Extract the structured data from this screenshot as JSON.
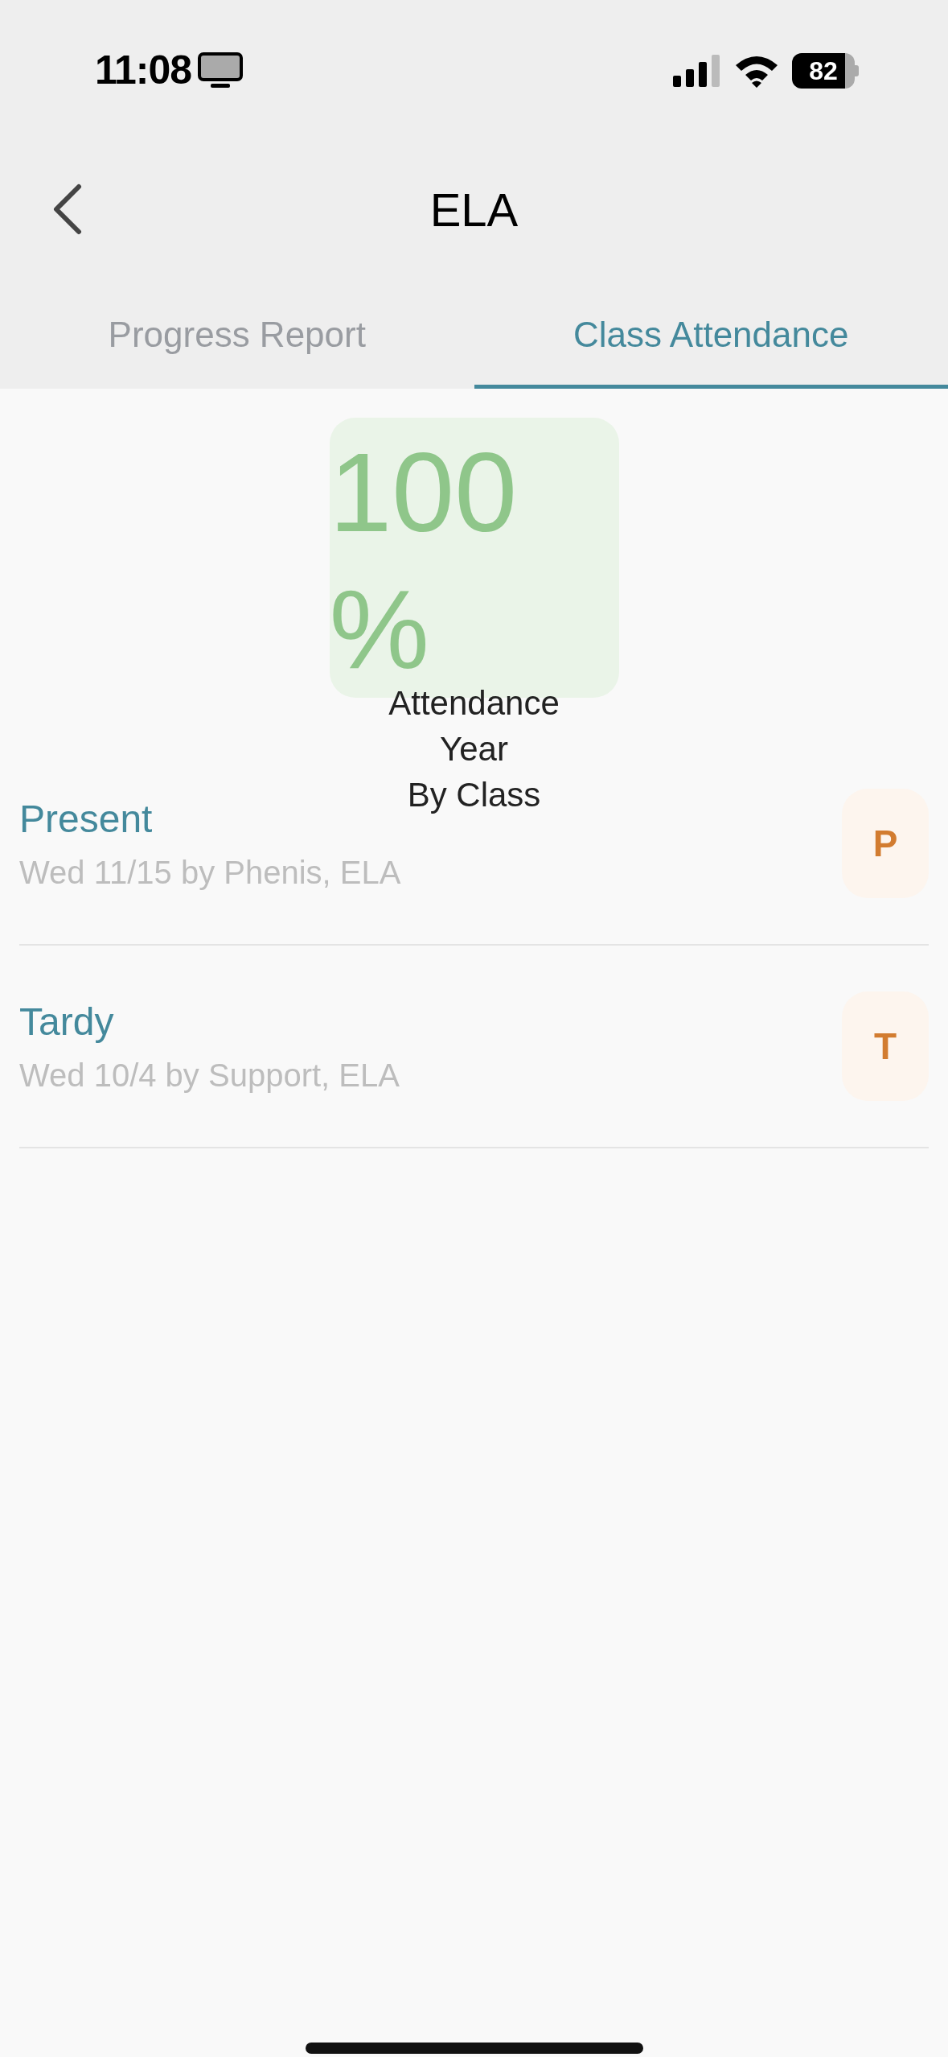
{
  "status_bar": {
    "time": "11:08",
    "battery": "82"
  },
  "header": {
    "title": "ELA"
  },
  "tabs": [
    {
      "label": "Progress Report",
      "selected": false
    },
    {
      "label": "Class Attendance",
      "selected": true
    }
  ],
  "summary": {
    "percentage": "100%",
    "label_lines": [
      "Attendance",
      "Year",
      "By Class"
    ]
  },
  "records": [
    {
      "status": "Present",
      "detail": "Wed 11/15 by Phenis, ELA",
      "code": "P"
    },
    {
      "status": "Tardy",
      "detail": "Wed 10/4 by Support, ELA",
      "code": "T"
    }
  ]
}
